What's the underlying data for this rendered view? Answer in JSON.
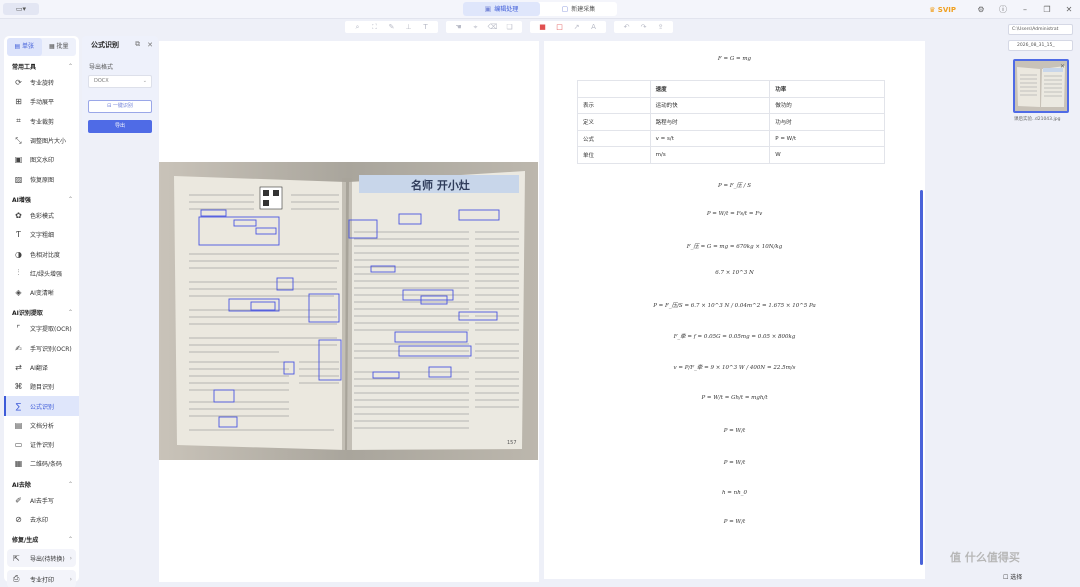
{
  "topbar": {
    "app_icon": "▭▾",
    "tabs": [
      {
        "label": "编辑处理",
        "active": true,
        "icon": "edit-icon"
      },
      {
        "label": "新建采集",
        "active": false,
        "icon": "new-capture-icon"
      }
    ],
    "svip": "SVIP",
    "window_icons": [
      "settings-icon",
      "help-icon",
      "minimize-icon",
      "maximize-icon",
      "close-icon"
    ]
  },
  "sidebar": {
    "tabs": [
      {
        "label": "单张",
        "active": true
      },
      {
        "label": "批量",
        "active": false
      }
    ],
    "sections": [
      {
        "title": "常用工具",
        "items": [
          {
            "label": "专业旋转",
            "icon": "rotate-icon"
          },
          {
            "label": "手动展平",
            "icon": "flatten-icon"
          },
          {
            "label": "专业裁剪",
            "icon": "crop-icon"
          },
          {
            "label": "调整图片大小",
            "icon": "resize-icon"
          },
          {
            "label": "图文水印",
            "icon": "watermark-icon"
          },
          {
            "label": "恢复原图",
            "icon": "restore-icon"
          }
        ]
      },
      {
        "title": "AI增强",
        "items": [
          {
            "label": "色彩模式",
            "icon": "color-mode-icon"
          },
          {
            "label": "文字粗细",
            "icon": "text-weight-icon"
          },
          {
            "label": "色相对比度",
            "icon": "contrast-icon"
          },
          {
            "label": "红/绿头增强",
            "icon": "enhance-icon"
          },
          {
            "label": "AI变清晰",
            "icon": "sharpen-icon"
          }
        ]
      },
      {
        "title": "AI识别提取",
        "items": [
          {
            "label": "文字提取(OCR)",
            "icon": "ocr-icon"
          },
          {
            "label": "手写识别(OCR)",
            "icon": "handwriting-icon"
          },
          {
            "label": "AI翻译",
            "icon": "translate-icon"
          },
          {
            "label": "题目识别",
            "icon": "question-icon"
          },
          {
            "label": "公式识别",
            "icon": "formula-icon",
            "active": true
          },
          {
            "label": "文档分析",
            "icon": "doc-analysis-icon"
          },
          {
            "label": "证件识别",
            "icon": "id-card-icon"
          },
          {
            "label": "二维码/条码",
            "icon": "qrcode-icon"
          }
        ]
      },
      {
        "title": "AI去除",
        "items": [
          {
            "label": "AI去手写",
            "icon": "erase-handwriting-icon"
          },
          {
            "label": "去水印",
            "icon": "remove-watermark-icon"
          }
        ]
      },
      {
        "title": "修复/生成",
        "items": []
      }
    ],
    "footer": [
      {
        "label": "导出(待转换)",
        "icon": "export-icon"
      },
      {
        "label": "专业打印",
        "icon": "print-icon"
      }
    ]
  },
  "panel": {
    "title": "公式识别",
    "export_label": "导出格式",
    "format_value": "DOCX",
    "recognize_button": "一键识别",
    "export_button": "导出"
  },
  "toolbar": {
    "icons": [
      "search-icon",
      "fit-icon",
      "brush-icon",
      "ruler-icon",
      "text-icon",
      "hand-icon",
      "tag-icon",
      "eraser-icon",
      "copy-icon",
      "red-square-icon",
      "outline-square-icon",
      "arrow-icon",
      "text-box-icon",
      "undo-icon",
      "redo-icon",
      "share-icon"
    ]
  },
  "result": {
    "top_formula": "F = G = mg",
    "table": {
      "header": [
        "",
        "速度",
        "功率"
      ],
      "rows": [
        [
          "表示",
          "运动的快",
          "做功的"
        ],
        [
          "定义",
          "路程与时",
          "功与时"
        ],
        [
          "公式",
          "v = s/t",
          "P = W/t"
        ],
        [
          "单位",
          "m/s",
          "W"
        ]
      ]
    },
    "formulas": [
      "P = F_压 / S",
      "P = W/t = Fs/t = Fv",
      "F_压 = G = mg = 670kg × 10N/kg",
      "6.7 × 10^3 N",
      "P = F_压/S = 6.7 × 10^3 N / 0.04m^2 = 1.675 × 10^5 Pa",
      "F_牵 = f = 0.05G = 0.05mg = 0.05 × 800kg",
      "v = P/F_牵 = 9 × 10^3 W / 400N = 22.5m/s",
      "P = W/t = Gh/t = mgh/t",
      "P = W/t",
      "P = W/t",
      "h = nh_0",
      "P = W/t"
    ]
  },
  "thumbnails": {
    "path": "C:\\Users\\Administrat",
    "folder": "2026_08_31_15_",
    "file_name": "课后实验..d21043.jpg"
  },
  "footer": {
    "select_label": "选择",
    "watermark": "值 什么值得买"
  },
  "photo": {
    "banner_title": "名师 开小灶",
    "page_number": "157"
  }
}
